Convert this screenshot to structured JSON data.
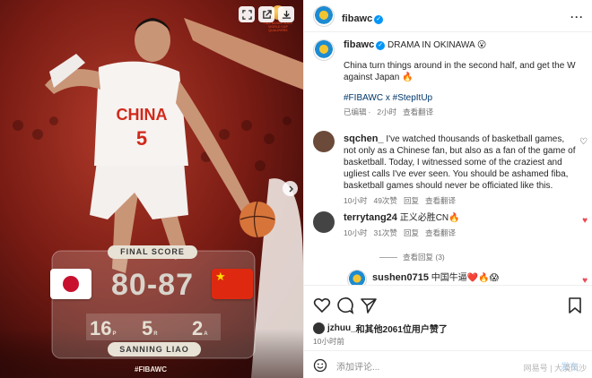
{
  "media": {
    "final_score_label": "FINAL SCORE",
    "score": "80-87",
    "jersey_name": "CHINA",
    "jersey_number": "5",
    "stats": [
      {
        "value": "16",
        "unit": "P"
      },
      {
        "value": "5",
        "unit": "R"
      },
      {
        "value": "2",
        "unit": "A"
      }
    ],
    "player_name": "SANNING LIAO",
    "hashtag": "#FIBAWC",
    "event_logo_text": "FIBA BASKETBALL WORLD CUP QUALIFIERS",
    "icons": {
      "expand": "expand-icon",
      "share": "share-icon",
      "download": "download-icon",
      "next": "chevron-right-icon"
    }
  },
  "header": {
    "username": "fibawc",
    "more": "···"
  },
  "caption": {
    "username": "fibawc",
    "headline": "DRAMA IN OKINAWA 😮",
    "body": "China turn things around in the second half, and get the W against Japan 🔥",
    "tags": "#FIBAWC x #StepItUp",
    "edited": "已编辑",
    "time": "2小时",
    "translate": "查看翻译"
  },
  "comments": [
    {
      "username": "sqchen_",
      "text": "I've watched thousands of basketball games, not only as a Chinese fan, but also as a fan of the game of basketball. Today, I witnessed some of the craziest and ugliest calls I've ever seen. You should be ashamed fiba, basketball games should never be officiated like this.",
      "time": "10小时",
      "likes": "49次赞",
      "reply": "回复",
      "translate": "查看翻译",
      "liked": false
    },
    {
      "username": "terrytang24",
      "text": "正义必胜CN🔥",
      "time": "10小时",
      "likes": "31次赞",
      "reply": "回复",
      "translate": "查看翻译",
      "liked": true
    },
    {
      "username": "sushen0715",
      "text": "中国牛逼❤️🔥😱",
      "liked": true
    }
  ],
  "view_replies": "查看回复 (3)",
  "actions": {
    "liked_by_user": "jzhuu_",
    "liked_by_text": "和其他2061位用户赞了",
    "time": "10小时前",
    "add_comment_placeholder": "添加评论...",
    "post_label": "发布"
  },
  "watermark": "网易号 | 大漠风沙",
  "colors": {
    "link": "#00376b",
    "heart": "#ed4956",
    "verified": "#0095f6"
  }
}
